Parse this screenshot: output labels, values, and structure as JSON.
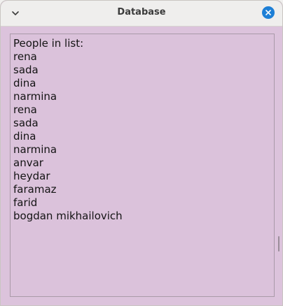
{
  "window": {
    "title": "Database"
  },
  "list": {
    "items": [
      "People in list:",
      "rena",
      "sada",
      "dina",
      "narmina",
      "rena",
      "sada",
      "dina",
      "narmina",
      "anvar",
      "heydar",
      "faramaz",
      "farid",
      "bogdan mikhailovich"
    ]
  },
  "colors": {
    "background": "#dbc2db",
    "titlebar": "#efeeed",
    "close_button": "#1e7fd6",
    "text": "#141414"
  },
  "icons": {
    "menu": "chevron-down-icon",
    "close": "close-icon"
  }
}
